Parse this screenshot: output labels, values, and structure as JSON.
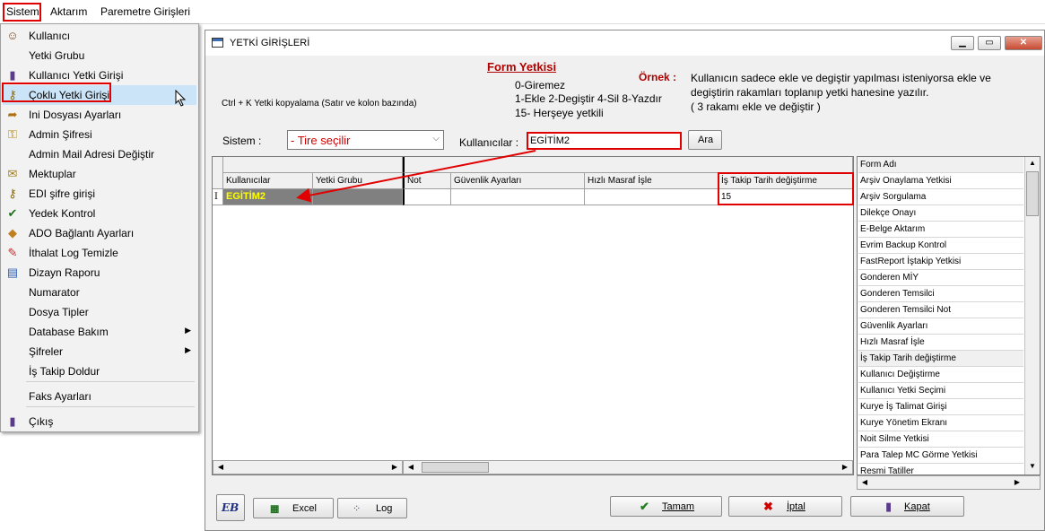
{
  "menubar": {
    "items": [
      "Sistem",
      "Aktarım",
      "Paremetre Girişleri"
    ]
  },
  "menu": {
    "items": [
      {
        "label": "Kullanıcı",
        "icon": "user-icon",
        "glyph": "☺",
        "color": "#7a4a20",
        "submenu": false
      },
      {
        "label": "Yetki Grubu",
        "icon": "",
        "glyph": "",
        "color": "#000000",
        "submenu": false
      },
      {
        "label": "Kullanıcı Yetki Girişi",
        "icon": "bottle-icon",
        "glyph": "▮",
        "color": "#5a3a8a",
        "submenu": false
      },
      {
        "label": "Çoklu Yetki Girişi",
        "icon": "keys-icon",
        "glyph": "⚷",
        "color": "#8a6a10",
        "submenu": false,
        "selected": true
      },
      {
        "label": "Ini Dosyası  Ayarları",
        "icon": "ini-file-icon",
        "glyph": "➦",
        "color": "#b07010",
        "submenu": false
      },
      {
        "label": "Admin Şifresi",
        "icon": "key-icon",
        "glyph": "⚿",
        "color": "#b08a10",
        "submenu": false
      },
      {
        "label": "Admin Mail Adresi Değiştir",
        "icon": "",
        "glyph": "",
        "color": "#000000",
        "submenu": false
      },
      {
        "label": "Mektuplar",
        "icon": "letters-icon",
        "glyph": "✉",
        "color": "#a08020",
        "submenu": false
      },
      {
        "label": "EDI şifre girişi",
        "icon": "edi-key-icon",
        "glyph": "⚷",
        "color": "#8a6a10",
        "submenu": false
      },
      {
        "label": "Yedek Kontrol",
        "icon": "backup-icon",
        "glyph": "✔",
        "color": "#207020",
        "submenu": false
      },
      {
        "label": "ADO Bağlantı Ayarları",
        "icon": "connection-icon",
        "glyph": "◆",
        "color": "#c08020",
        "submenu": false
      },
      {
        "label": "İthalat Log Temizle",
        "icon": "clean-log-icon",
        "glyph": "✎",
        "color": "#c03030",
        "submenu": false
      },
      {
        "label": "Dizayn Raporu",
        "icon": "report-icon",
        "glyph": "▤",
        "color": "#3060b0",
        "submenu": false
      },
      {
        "label": "Numarator",
        "icon": "",
        "glyph": "",
        "color": "#000000",
        "submenu": false
      },
      {
        "label": "Dosya Tipler",
        "icon": "",
        "glyph": "",
        "color": "#000000",
        "submenu": false
      },
      {
        "label": "Database Bakım",
        "icon": "",
        "glyph": "",
        "color": "#000000",
        "submenu": true
      },
      {
        "label": "Şifreler",
        "icon": "",
        "glyph": "",
        "color": "#000000",
        "submenu": true
      },
      {
        "label": "İş Takip Doldur",
        "icon": "",
        "glyph": "",
        "color": "#000000",
        "submenu": false
      },
      {
        "label": "Faks Ayarları",
        "icon": "",
        "glyph": "",
        "color": "#000000",
        "submenu": false
      },
      {
        "label": "Çıkış",
        "icon": "exit-icon",
        "glyph": "▮",
        "color": "#5a3a8a",
        "submenu": false
      }
    ]
  },
  "window": {
    "title": "YETKİ GİRİŞLERİ"
  },
  "header": {
    "form_title": "Form Yetkisi",
    "copy_hint": "Ctrl + K Yetki kopyalama (Satır ve kolon bazında)",
    "codes": [
      "0-Giremez",
      "1-Ekle  2-Degiştir  4-Sil  8-Yazdır",
      "15- Herşeye yetkili"
    ],
    "example_label": "Örnek :",
    "example_lines": [
      "Kullanıcın sadece ekle ve degiştir yapılması isteniyorsa  ekle ve",
      "degiştirin rakamları toplanıp yetki hanesine yazılır.",
      " ( 3 rakamı ekle ve değiştir )"
    ]
  },
  "filters": {
    "sistem_label": "Sistem :",
    "sistem_value": "- Tire seçilir",
    "kullanicilar_label": "Kullanıcılar :",
    "kullanicilar_value": "EGİTİM2",
    "search_button": "Ara"
  },
  "grid": {
    "columns": [
      "Kullanıcılar",
      "Yetki Grubu",
      "Not",
      "Güvenlik Ayarları",
      "Hızlı Masraf İşle",
      "İş Takip Tarih değiştirme"
    ],
    "row_indicator": "I",
    "rows": [
      {
        "user": "EGİTİM2",
        "group": "",
        "not": "",
        "guvenlik": "",
        "hizli": "",
        "is_takip": "15"
      }
    ]
  },
  "form_list": {
    "header": "Form Adı",
    "items": [
      "Arşiv Onaylama Yetkisi",
      "Arşiv Sorgulama",
      "Dilekçe Onayı",
      "E-Belge Aktarım",
      "Evrim Backup Kontrol",
      "FastReport İştakip Yetkisi",
      "Gonderen MİY",
      "Gonderen Temsilci",
      "Gonderen Temsilci Not",
      "Güvenlik Ayarları",
      "Hızlı Masraf İşle",
      "İş Takip Tarih değiştirme",
      "Kullanıcı Değiştirme",
      "Kullanıcı Yetki Seçimi",
      "Kurye İş Talimat Girişi",
      "Kurye Yönetim Ekranı",
      "Noit Silme Yetkisi",
      "Para Talep MC Görme Yetkisi",
      "Resmi Tatiller"
    ],
    "selected_index": 11
  },
  "buttons": {
    "excel": "Excel",
    "log": "Log",
    "tamam": "Tamam",
    "iptal": "İptal",
    "kapat": "Kapat"
  },
  "colors": {
    "highlight_red": "#e00000",
    "title_red": "#b00000",
    "user_cell_bg": "#808080",
    "user_cell_text": "#ffff00",
    "selection_blue": "#cce4f7"
  }
}
